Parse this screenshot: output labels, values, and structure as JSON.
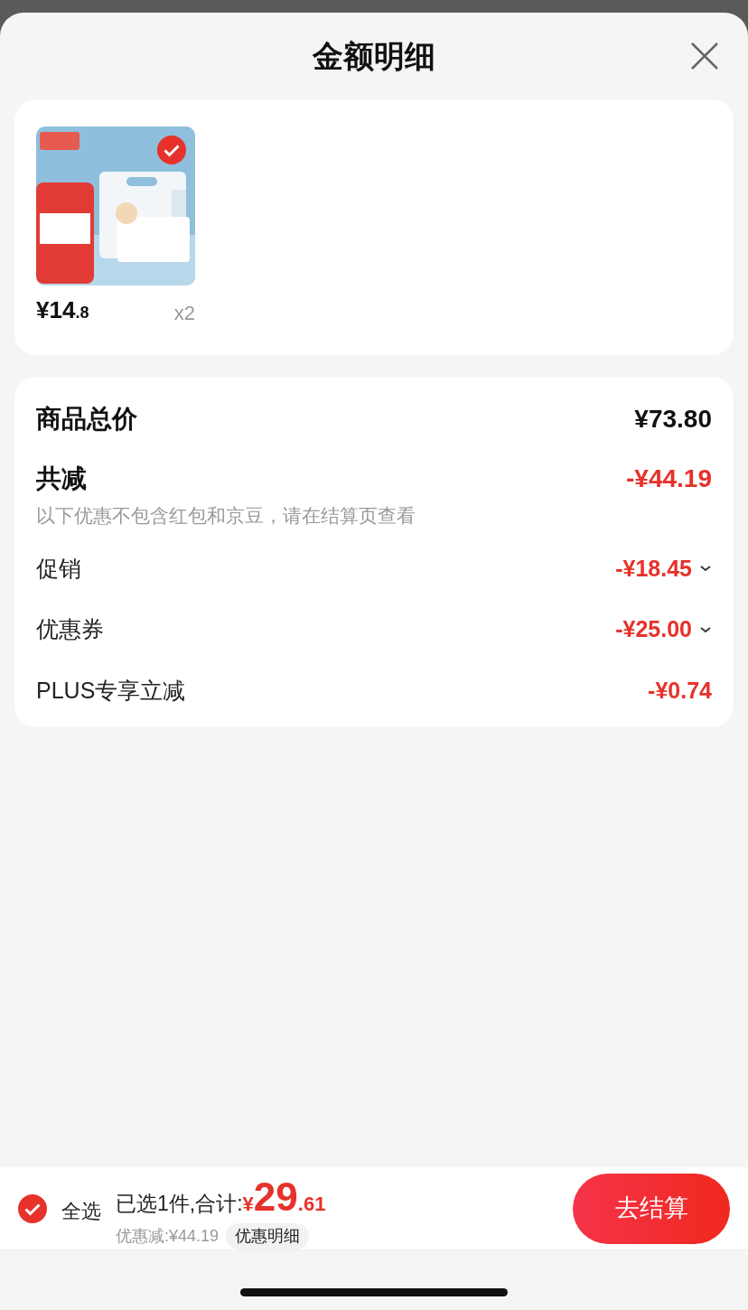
{
  "sheet": {
    "title": "金额明细"
  },
  "items": [
    {
      "kind": "picture",
      "selected": true,
      "price_integer": "¥14",
      "price_decimal": ".8",
      "quantity": "x2"
    }
  ],
  "summary": {
    "total_label": "商品总价",
    "total_value": "¥73.80",
    "reduce_label": "共减",
    "reduce_value": "-¥44.19",
    "note": "以下优惠不包含红包和京豆，请在结算页查看",
    "lines": [
      {
        "label": "促销",
        "value": "-¥18.45",
        "expandable": true
      },
      {
        "label": "优惠券",
        "value": "-¥25.00",
        "expandable": true
      },
      {
        "label": "PLUS专享立减",
        "value": "-¥0.74",
        "expandable": false
      }
    ]
  },
  "footer": {
    "select_all": {
      "label": "全选",
      "checked": true
    },
    "total_prefix": "已选1件,合计:",
    "total_currency": "¥",
    "total_integer": "29",
    "total_decimal": ".61",
    "discount": "优惠减:¥44.19",
    "discount_details": "优惠明细",
    "checkout": "去结算"
  }
}
